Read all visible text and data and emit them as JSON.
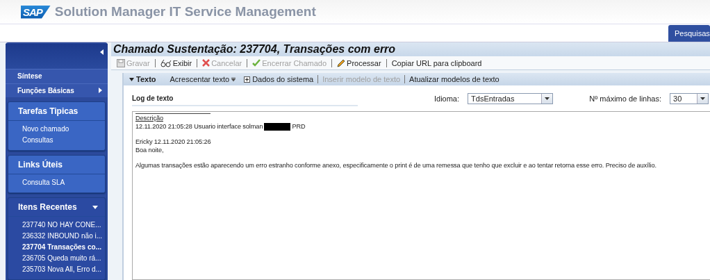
{
  "header": {
    "logo": "SAP",
    "title": "Solution Manager IT Service Management"
  },
  "search_button": "Pesquisas",
  "sidebar": {
    "links": [
      {
        "label": "Síntese",
        "has_submenu": false
      },
      {
        "label": "Funções Básicas",
        "has_submenu": true
      }
    ],
    "panels": [
      {
        "title": "Tarefas Tipicas",
        "collapsible": false,
        "items": [
          {
            "label": "Novo chamado",
            "selected": false
          },
          {
            "label": "Consultas",
            "selected": false
          }
        ]
      },
      {
        "title": "Links Úteis",
        "collapsible": false,
        "items": [
          {
            "label": "Consulta SLA",
            "selected": false
          }
        ]
      },
      {
        "title": "Itens Recentes",
        "collapsible": true,
        "items": [
          {
            "label": "237740 NO HAY CONE...",
            "selected": false
          },
          {
            "label": "236332 INBOUND não i...",
            "selected": false
          },
          {
            "label": "237704 Transações co...",
            "selected": true
          },
          {
            "label": "236705 Queda muito rá...",
            "selected": false
          },
          {
            "label": "235703 Nova All, Erro d...",
            "selected": false
          }
        ]
      }
    ]
  },
  "page_title": "Chamado Sustentação: 237704, Transações com erro",
  "toolbar": [
    {
      "kind": "save",
      "label": "Gravar",
      "disabled": true
    },
    {
      "kind": "glasses",
      "label": "Exibir",
      "disabled": false
    },
    {
      "kind": "cancel",
      "label": "Cancelar",
      "disabled": true
    },
    {
      "kind": "check",
      "label": "Encerrar Chamado",
      "disabled": true
    },
    {
      "kind": "pencil",
      "label": "Processar",
      "disabled": false
    },
    {
      "kind": "plain",
      "label": "Copiar URL para clipboard",
      "disabled": false
    }
  ],
  "section": {
    "title": "Texto",
    "expanded": true,
    "actions": [
      {
        "kind": "menu",
        "label": "Acrescentar texto",
        "disabled": false
      },
      {
        "kind": "plus",
        "label": "Dados do sistema",
        "disabled": false
      },
      {
        "kind": "plain",
        "label": "Inserir modelo de texto",
        "disabled": true
      },
      {
        "kind": "plain",
        "label": "Atualizar modelos de texto",
        "disabled": false
      }
    ]
  },
  "log": {
    "title": "Log de texto",
    "language_label": "Idioma:",
    "language_value": "TdsEntradas",
    "max_lines_label": "Nº máximo de linhas:",
    "max_lines_value": "30",
    "heading": "Descrição",
    "entry_line": {
      "before": "12.11.2020   21:05:28   Usuario interface solman",
      "redacted": true,
      "after": "PRD"
    },
    "lines": [
      {
        "text": "Ericky  12.11.2020  21:05:26",
        "gap_before": true
      },
      {
        "text": "Boa noite,",
        "gap_before": false
      },
      {
        "text": "Algumas transações estão aparecendo um erro estranho conforme anexo, especificamente o print é de uma remessa que tenho que excluir e ao tentar retorna esse erro. Preciso de auxílio.",
        "gap_before": true
      }
    ]
  }
}
